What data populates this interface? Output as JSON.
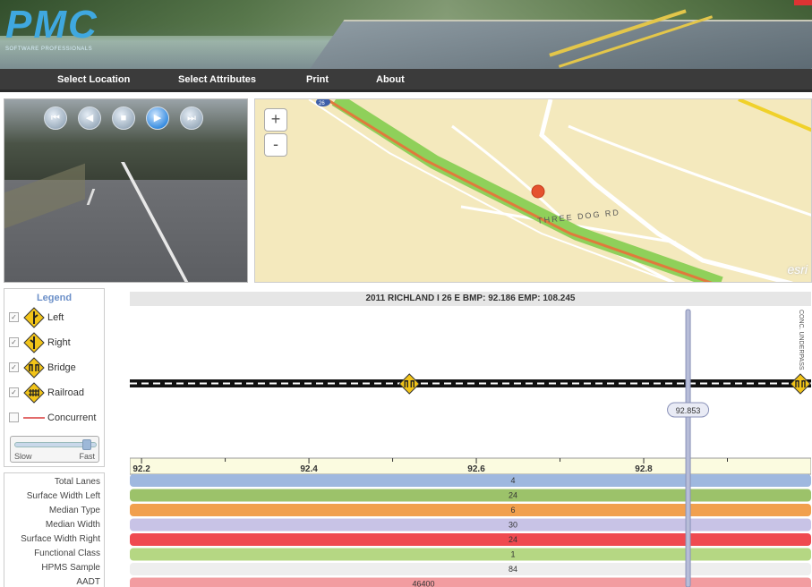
{
  "logo": {
    "text": "PMC",
    "tagline": "SOFTWARE PROFESSIONALS"
  },
  "nav": [
    {
      "label": "Select Location"
    },
    {
      "label": "Select Attributes"
    },
    {
      "label": "Print"
    },
    {
      "label": "About"
    }
  ],
  "video_controls": [
    "first-frame-icon",
    "previous-icon",
    "stop-icon",
    "play-icon",
    "next-icon"
  ],
  "map": {
    "zoom_in": "+",
    "zoom_out": "-",
    "route_shield": "26",
    "road_label": "THREE DOG RD",
    "attribution": "esri"
  },
  "legend": {
    "title": "Legend",
    "items": [
      {
        "label": "Left",
        "checked": true,
        "icon": "left-merge-sign-icon"
      },
      {
        "label": "Right",
        "checked": true,
        "icon": "right-merge-sign-icon"
      },
      {
        "label": "Bridge",
        "checked": true,
        "icon": "bridge-sign-icon"
      },
      {
        "label": "Railroad",
        "checked": true,
        "icon": "railroad-sign-icon"
      },
      {
        "label": "Concurrent",
        "checked": false,
        "icon": "concurrent-line-icon"
      }
    ],
    "speed": {
      "slow": "Slow",
      "fast": "Fast",
      "level": 0.95
    }
  },
  "strip": {
    "title": "2011 RICHLAND I 26 E BMP: 92.186 EMP: 108.245",
    "cursor_value": "92.853",
    "vertical_annotation": "CONC. UNDERPASS",
    "axis_ticks": [
      "92.2",
      "92.4",
      "92.6",
      "92.8"
    ],
    "features": [
      {
        "type": "bridge",
        "milepost": 92.52
      },
      {
        "type": "bridge",
        "milepost": 93.0
      }
    ],
    "attributes": [
      {
        "label": "Total Lanes",
        "value": "4",
        "color": "#9fb8df"
      },
      {
        "label": "Surface Width Left",
        "value": "24",
        "color": "#9cc26a"
      },
      {
        "label": "Median Type",
        "value": "6",
        "color": "#f1a04e"
      },
      {
        "label": "Median Width",
        "value": "30",
        "color": "#c8c3e6"
      },
      {
        "label": "Surface Width Right",
        "value": "24",
        "color": "#ef4a50"
      },
      {
        "label": "Functional Class",
        "value": "1",
        "color": "#b5d783"
      },
      {
        "label": "HPMS Sample",
        "value": "84",
        "color": "#eeeeee"
      },
      {
        "label": "AADT",
        "value": "46400",
        "color": "#f29ca0"
      }
    ],
    "axis": {
      "min": 92.186,
      "max": 93.0,
      "cursor": 92.853
    }
  }
}
